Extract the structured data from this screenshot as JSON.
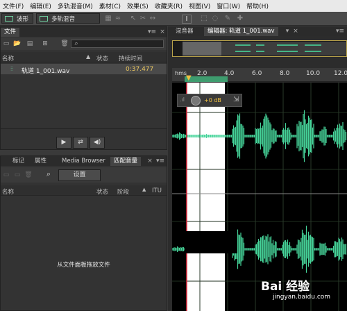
{
  "menubar": [
    "文件(F)",
    "编辑(E)",
    "多轨混音(M)",
    "素材(C)",
    "效果(S)",
    "收藏夹(R)",
    "视图(V)",
    "窗口(W)",
    "帮助(H)"
  ],
  "toolbar": {
    "waveform_label": "波形",
    "multitrack_label": "多轨混音"
  },
  "files_panel": {
    "title": "文件",
    "columns": {
      "name": "名称",
      "status": "状态",
      "duration": "持续时间"
    },
    "rows": [
      {
        "name": "轨道 1_001.wav",
        "duration": "0:37.477"
      }
    ]
  },
  "match_panel": {
    "tabs": [
      "标记",
      "属性",
      "Media Browser",
      "匹配音量"
    ],
    "settings_button": "设置",
    "columns": {
      "name": "名称",
      "status": "状态",
      "stage": "阶段",
      "itu": "ITU"
    },
    "empty_hint": "从文件面板拖放文件"
  },
  "editor": {
    "tabs": {
      "mixer": "混音器",
      "editor": "编辑器: 轨道 1_001.wav"
    },
    "ruler": {
      "unit": "hms",
      "ticks": [
        "2.0",
        "4.0",
        "6.0",
        "8.0",
        "10.0",
        "12.0"
      ]
    },
    "hud": {
      "volume": "+0 dB"
    }
  },
  "colors": {
    "waveform": "#46d49a",
    "selection": "#ffffff",
    "playhead": "#e0283c",
    "accent": "#6fd1a0"
  },
  "watermark": {
    "brand": "Bai 经验",
    "url": "jingyan.baidu.com"
  }
}
